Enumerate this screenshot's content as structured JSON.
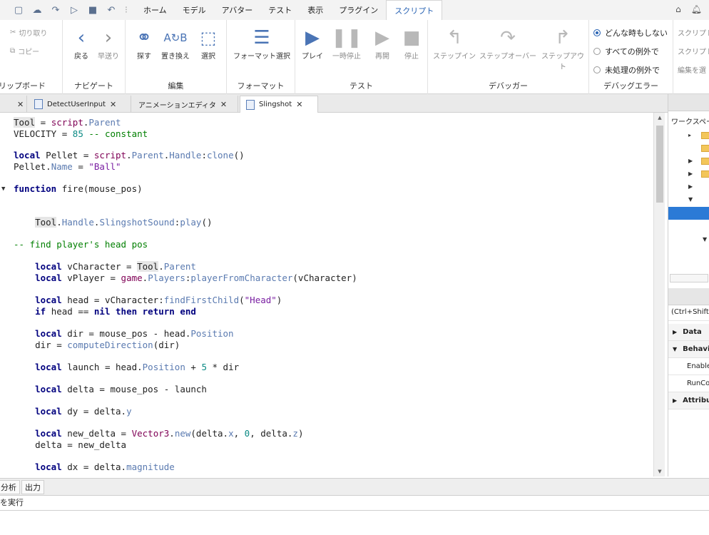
{
  "menu": {
    "items": [
      "ホーム",
      "モデル",
      "アバター",
      "テスト",
      "表示",
      "プラグイン",
      "スクリプト"
    ],
    "active_index": 6
  },
  "ribbon": {
    "clipboard": {
      "cut": "切り取り",
      "copy": "コピー",
      "label": "リップボード"
    },
    "navigate": {
      "back": "戻る",
      "forward": "早送り",
      "label": "ナビゲート"
    },
    "edit": {
      "find": "探す",
      "replace": "置き換え",
      "select": "選択",
      "label": "編集"
    },
    "format": {
      "format_selection": "フォーマット選択",
      "label": "フォーマット"
    },
    "test": {
      "play": "プレイ",
      "pause": "一時停止",
      "resume": "再開",
      "stop": "停止",
      "label": "テスト"
    },
    "debugger": {
      "step_in": "ステップイン",
      "step_over": "ステップオーバー",
      "step_out": "ステップアウト",
      "label": "デバッガー"
    },
    "debug_errors": {
      "options": [
        "どんな時もしない",
        "すべての例外で",
        "未処理の例外で"
      ],
      "selected_index": 0,
      "label": "デバッグエラー"
    },
    "script_clip": [
      "スクリプト",
      "スクリプト",
      "編集を選"
    ]
  },
  "doc_tabs": [
    {
      "label": "DetectUserInput",
      "active": false
    },
    {
      "label": "アニメーションエディタ",
      "active": false
    },
    {
      "label": "Slingshot",
      "active": true
    }
  ],
  "right_panel": {
    "explorer_title": "ワークスペース",
    "filter_placeholder": "(Ctrl+Shift",
    "properties": [
      "Data",
      "Behavior",
      "Enabled",
      "RunContext",
      "Attributes"
    ]
  },
  "bottom_tabs": [
    "分析",
    "出力"
  ],
  "command_bar": "を実行",
  "code_lines": [
    "Tool = script.Parent",
    "VELOCITY = 85 -- constant",
    "",
    "local Pellet = script.Parent.Handle:clone()",
    "Pellet.Name = \"Ball\"",
    "",
    "function fire(mouse_pos)",
    "",
    "",
    "    Tool.Handle.SlingshotSound:play()",
    "",
    "-- find player's head pos",
    "",
    "    local vCharacter = Tool.Parent",
    "    local vPlayer = game.Players:playerFromCharacter(vCharacter)",
    "",
    "    local head = vCharacter:findFirstChild(\"Head\")",
    "    if head == nil then return end",
    "",
    "    local dir = mouse_pos - head.Position",
    "    dir = computeDirection(dir)",
    "",
    "    local launch = head.Position + 5 * dir",
    "",
    "    local delta = mouse_pos - launch",
    "",
    "    local dy = delta.y",
    "",
    "    local new_delta = Vector3.new(delta.x, 0, delta.z)",
    "    delta = new_delta",
    "",
    "    local dx = delta.magnitude"
  ]
}
